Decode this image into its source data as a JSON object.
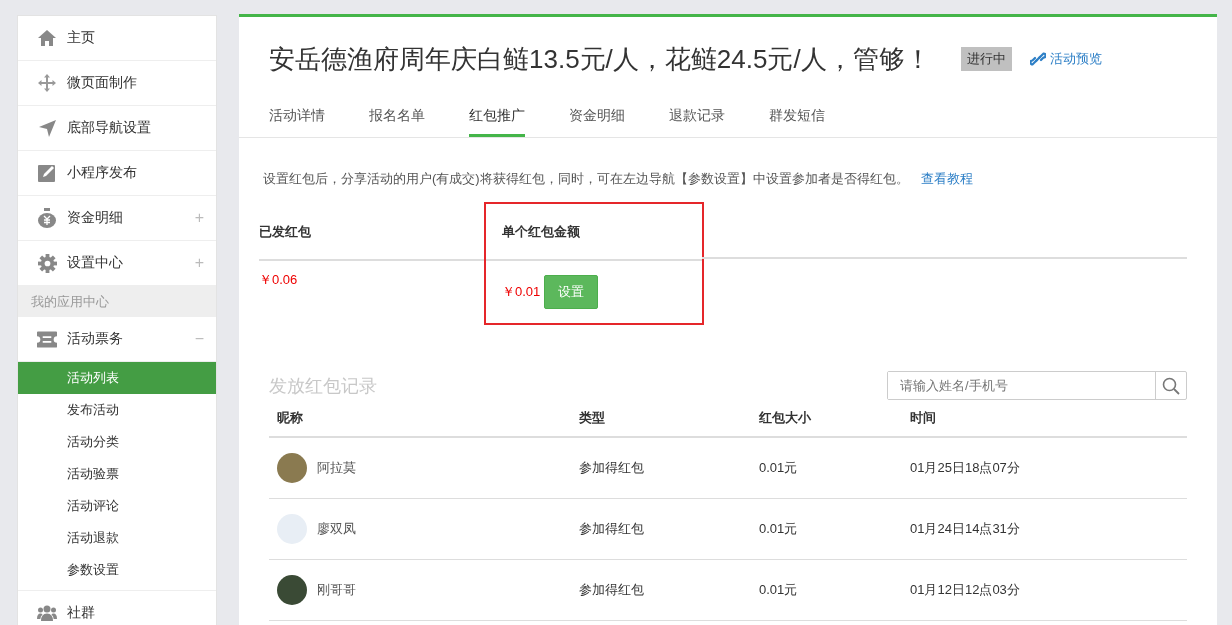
{
  "sidebar": {
    "items": [
      {
        "kind": "nav",
        "label": "主页"
      },
      {
        "kind": "nav",
        "label": "微页面制作"
      },
      {
        "kind": "nav",
        "label": "底部导航设置"
      },
      {
        "kind": "nav",
        "label": "小程序发布"
      },
      {
        "kind": "nav",
        "label": "资金明细",
        "sign": "+"
      },
      {
        "kind": "nav",
        "label": "设置中心",
        "sign": "+"
      },
      {
        "kind": "section",
        "label": "我的应用中心"
      },
      {
        "kind": "nav",
        "label": "活动票务",
        "sign": "−",
        "children": [
          {
            "label": "活动列表",
            "selected": true
          },
          {
            "label": "发布活动",
            "selected": false
          },
          {
            "label": "活动分类",
            "selected": false
          },
          {
            "label": "活动验票",
            "selected": false
          },
          {
            "label": "活动评论",
            "selected": false
          },
          {
            "label": "活动退款",
            "selected": false
          },
          {
            "label": "参数设置",
            "selected": false
          }
        ]
      },
      {
        "kind": "nav",
        "label": "社群"
      }
    ]
  },
  "header": {
    "title": "安岳德渔府周年庆白鲢13.5元/人，花鲢24.5元/人，管够！",
    "status": "进行中",
    "preview_link": "活动预览"
  },
  "tabs": [
    {
      "label": "活动详情",
      "selected": false
    },
    {
      "label": "报名名单",
      "selected": false
    },
    {
      "label": "红包推广",
      "selected": true
    },
    {
      "label": "资金明细",
      "selected": false
    },
    {
      "label": "退款记录",
      "selected": false
    },
    {
      "label": "群发短信",
      "selected": false
    }
  ],
  "notice": {
    "text": "设置红包后，分享活动的用户(有成交)将获得红包，同时，可在左边导航【参数设置】中设置参加者是否得红包。",
    "link": "查看教程"
  },
  "summary": {
    "sent_label": "已发红包",
    "sent_value": "￥0.06",
    "single_label": "单个红包金额",
    "single_value": "￥0.01",
    "set_button": "设置"
  },
  "records": {
    "title": "发放红包记录",
    "search": {
      "placeholder": "请输入姓名/手机号"
    },
    "columns": [
      "昵称",
      "类型",
      "红包大小",
      "时间"
    ],
    "rows": [
      {
        "name": "阿拉莫",
        "type": "参加得红包",
        "amount": "0.01元",
        "time": "01月25日18点07分"
      },
      {
        "name": "廖双凤",
        "type": "参加得红包",
        "amount": "0.01元",
        "time": "01月24日14点31分"
      },
      {
        "name": "刚哥哥",
        "type": "参加得红包",
        "amount": "0.01元",
        "time": "01月12日12点03分"
      }
    ]
  }
}
